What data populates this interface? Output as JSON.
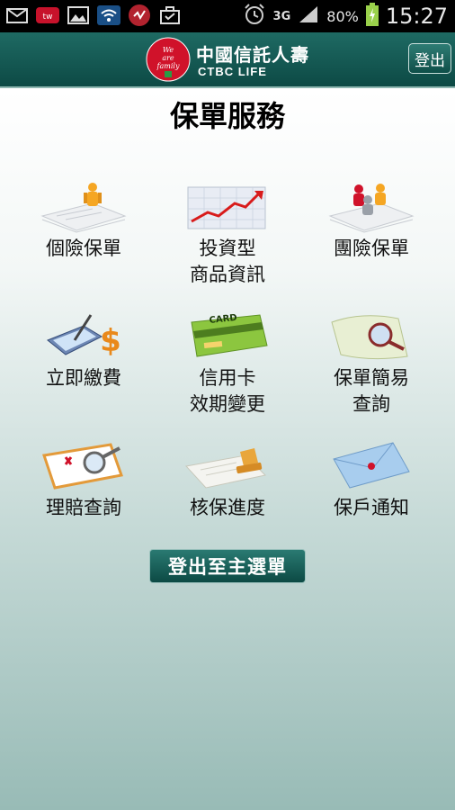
{
  "status_bar": {
    "time": "15:27",
    "battery_pct": "80%",
    "network": "3G",
    "icons": [
      "mail-icon",
      "taiwanmobile-icon",
      "gallery-icon",
      "wifi-icon",
      "tool-icon",
      "briefcase-icon",
      "alarm-icon",
      "signal-icon",
      "battery-icon"
    ]
  },
  "header": {
    "brand_cn": "中國信託人壽",
    "brand_en": "CTBC LIFE",
    "logo_text": "We are family",
    "logout_label": "登出"
  },
  "page": {
    "title": "保單服務"
  },
  "menu": {
    "items": [
      {
        "line1": "個險保單",
        "line2": ""
      },
      {
        "line1": "投資型",
        "line2": "商品資訊"
      },
      {
        "line1": "團險保單",
        "line2": ""
      },
      {
        "line1": "立即繳費",
        "line2": ""
      },
      {
        "line1": "信用卡",
        "line2": "效期變更"
      },
      {
        "line1": "保單簡易",
        "line2": "查詢"
      },
      {
        "line1": "理賠查詢",
        "line2": ""
      },
      {
        "line1": "核保進度",
        "line2": ""
      },
      {
        "line1": "保戶通知",
        "line2": ""
      }
    ]
  },
  "card_text": "CARD",
  "main_menu_button": "登出至主選單",
  "colors": {
    "header": "#0d4a45",
    "accent_red": "#d0122a",
    "button": "#0c4a44"
  }
}
